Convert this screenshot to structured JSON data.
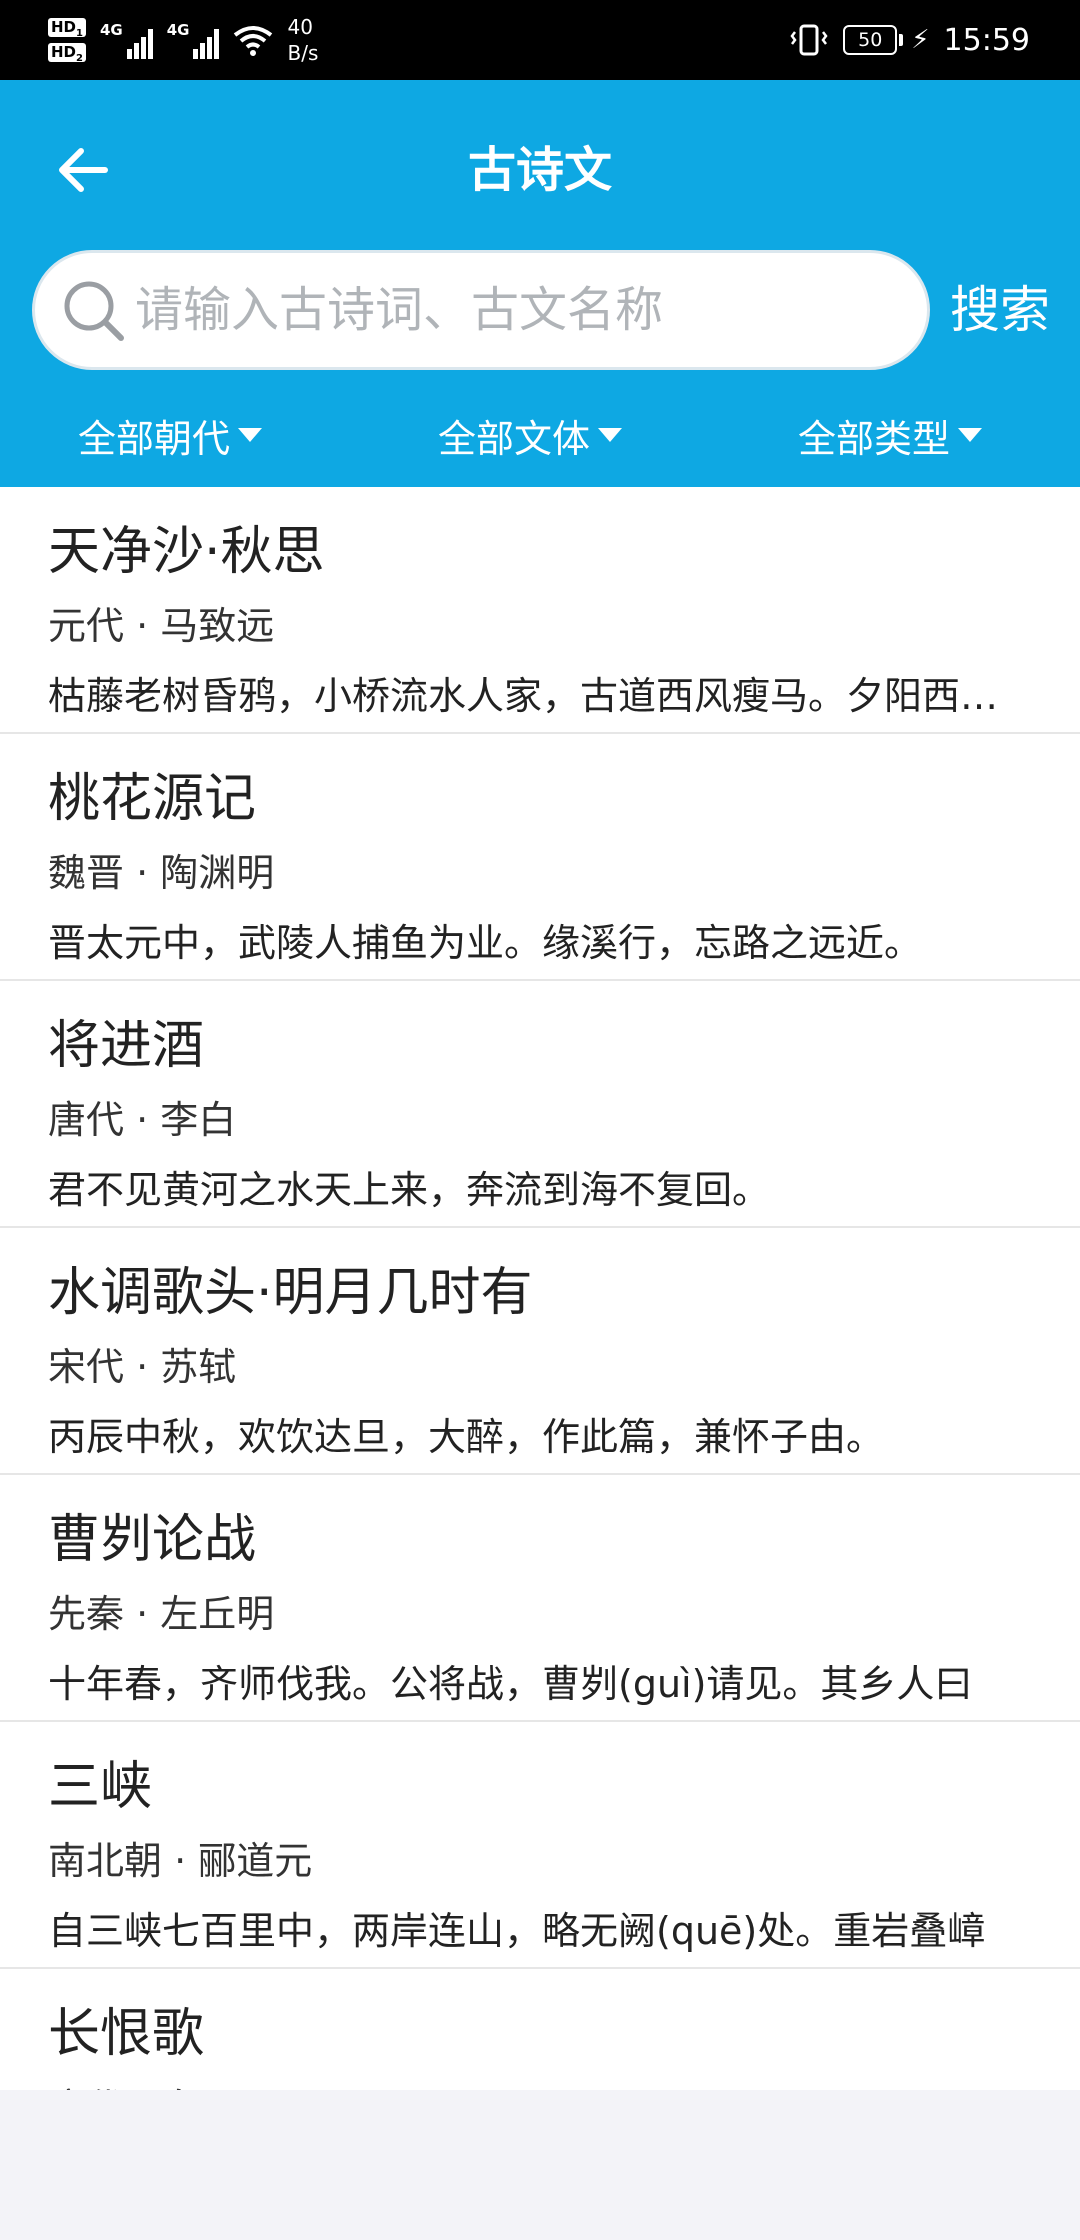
{
  "status_bar": {
    "hd1": "HD",
    "hd1_sub": "1",
    "hd2": "HD",
    "hd2_sub": "2",
    "net1": "4G",
    "net2": "4G",
    "speed_value": "40",
    "speed_unit": "B/s",
    "battery": "50",
    "time": "15:59",
    "icons": [
      "hd-icon",
      "signal-icon",
      "wifi-icon",
      "vibrate-icon",
      "battery-icon",
      "charging-icon"
    ]
  },
  "header": {
    "title": "古诗文",
    "back_icon": "arrow-left-icon",
    "search": {
      "placeholder": "请输入古诗词、古文名称",
      "value": "",
      "button": "搜索"
    },
    "filters": [
      {
        "label": "全部朝代"
      },
      {
        "label": "全部文体"
      },
      {
        "label": "全部类型"
      }
    ],
    "color": "#0ea8e3"
  },
  "list": {
    "items": [
      {
        "title": "天净沙·秋思",
        "meta": "元代 · 马致远",
        "excerpt": "枯藤老树昏鸦，小桥流水人家，古道西风瘦马。夕阳西下，断肠人在天涯。"
      },
      {
        "title": "桃花源记",
        "meta": "魏晋 · 陶渊明",
        "excerpt": "晋太元中，武陵人捕鱼为业。缘溪行，忘路之远近。"
      },
      {
        "title": "将进酒",
        "meta": "唐代 · 李白",
        "excerpt": "君不见黄河之水天上来，奔流到海不复回。"
      },
      {
        "title": "水调歌头·明月几时有",
        "meta": "宋代 · 苏轼",
        "excerpt": "丙辰中秋，欢饮达旦，大醉，作此篇，兼怀子由。"
      },
      {
        "title": "曹刿论战",
        "meta": "先秦 · 左丘明",
        "excerpt": "十年春，齐师伐我。公将战，曹刿(guì)请见。其乡人曰"
      },
      {
        "title": "三峡",
        "meta": "南北朝 · 郦道元",
        "excerpt": "自三峡七百里中，两岸连山，略无阙(quē)处。重岩叠嶂"
      },
      {
        "title": "长恨歌",
        "meta": "唐代 · 白居易",
        "excerpt": ""
      }
    ]
  }
}
